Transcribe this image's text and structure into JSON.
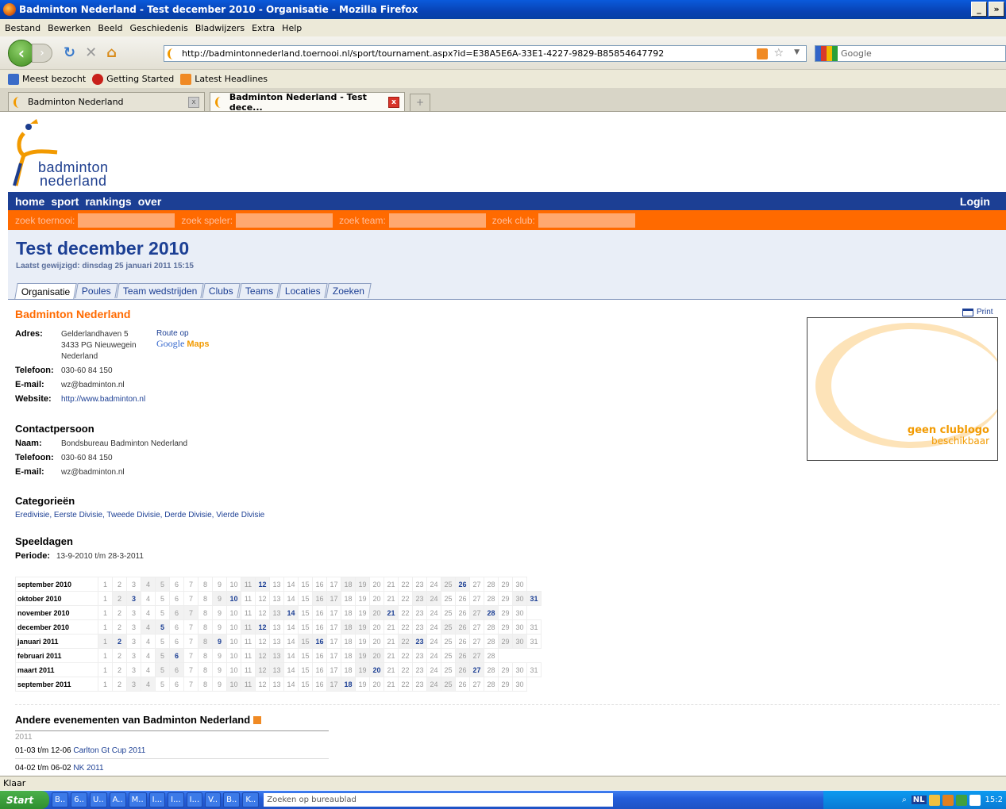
{
  "window": {
    "title": "Badminton Nederland - Test december 2010 - Organisatie - Mozilla Firefox",
    "min": "_",
    "max": "»"
  },
  "menu": [
    "Bestand",
    "Bewerken",
    "Beeld",
    "Geschiedenis",
    "Bladwijzers",
    "Extra",
    "Help"
  ],
  "url": "http://badmintonnederland.toernooi.nl/sport/tournament.aspx?id=E38A5E6A-33E1-4227-9829-B85854647792",
  "search_placeholder": "Google",
  "bookmarks": [
    "Meest bezocht",
    "Getting Started",
    "Latest Headlines"
  ],
  "tabs": [
    {
      "label": "Badminton Nederland"
    },
    {
      "label": "Badminton Nederland - Test dece..."
    }
  ],
  "logo": {
    "line1": "badminton",
    "line2": "nederland"
  },
  "mainnav": {
    "items": [
      "home",
      "sport",
      "rankings",
      "over"
    ],
    "login": "Login"
  },
  "searchstrip": [
    "zoek toernooi:",
    "zoek speler:",
    "zoek team:",
    "zoek club:"
  ],
  "page": {
    "title": "Test december 2010",
    "subtitle": "Laatst gewijzigd: dinsdag 25 januari 2011 15:15",
    "tabs": [
      "Organisatie",
      "Poules",
      "Team wedstrijden",
      "Clubs",
      "Teams",
      "Locaties",
      "Zoeken"
    ]
  },
  "org": {
    "name": "Badminton Nederland",
    "print": "Print",
    "adres_label": "Adres:",
    "adres": [
      "Gelderlandhaven 5",
      "3433 PG Nieuwegein",
      "Nederland"
    ],
    "route": "Route op",
    "maps_google": "Google",
    "maps_maps": "Maps",
    "telefoon_label": "Telefoon:",
    "telefoon": "030-60 84 150",
    "email_label": "E-mail:",
    "email": "wz@badminton.nl",
    "website_label": "Website:",
    "website": "http://www.badminton.nl"
  },
  "logobox": {
    "line1": "geen clublogo",
    "line2": "beschikbaar"
  },
  "contact": {
    "heading": "Contactpersoon",
    "naam_label": "Naam:",
    "naam": "Bondsbureau Badminton Nederland",
    "telefoon_label": "Telefoon:",
    "telefoon": "030-60 84 150",
    "email_label": "E-mail:",
    "email": "wz@badminton.nl"
  },
  "categories": {
    "heading": "Categorieën",
    "list": "Eredivisie, Eerste Divisie, Tweede Divisie, Derde Divisie, Vierde Divisie"
  },
  "speeldagen": {
    "heading": "Speeldagen",
    "periode_label": "Periode:",
    "periode": "13-9-2010 t/m 28-3-2011",
    "months": [
      {
        "name": "september 2010",
        "days": 30,
        "highlight": [
          12,
          26
        ],
        "weekend_start": 4
      },
      {
        "name": "oktober 2010",
        "days": 31,
        "highlight": [
          3,
          10,
          31
        ],
        "weekend_start": 2
      },
      {
        "name": "november 2010",
        "days": 30,
        "highlight": [
          14,
          21,
          28
        ],
        "weekend_start": 6
      },
      {
        "name": "december 2010",
        "days": 31,
        "highlight": [
          5,
          12
        ],
        "weekend_start": 4
      },
      {
        "name": "januari 2011",
        "days": 31,
        "highlight": [
          2,
          9,
          16,
          23
        ],
        "weekend_start": 1
      },
      {
        "name": "februari 2011",
        "days": 28,
        "highlight": [
          6
        ],
        "weekend_start": 5
      },
      {
        "name": "maart 2011",
        "days": 31,
        "highlight": [
          20,
          27
        ],
        "weekend_start": 5
      },
      {
        "name": "september 2011",
        "days": 30,
        "highlight": [
          18
        ],
        "weekend_start": 3
      }
    ]
  },
  "events": {
    "heading": "Andere evenementen van Badminton Nederland",
    "year": "2011",
    "rows": [
      {
        "date": "01-03 t/m 12-06",
        "name": "Carlton Gt Cup 2011"
      },
      {
        "date": "04-02 t/m 06-02",
        "name": "NK 2011"
      }
    ]
  },
  "status": "Klaar",
  "taskbar": {
    "start": "Start",
    "items": [
      "B..",
      "6..",
      "U..",
      "A..",
      "M..",
      "I...",
      "I...",
      "I...",
      "V..",
      "B..",
      "K.."
    ],
    "search": "Zoeken op bureaublad",
    "lang": "NL",
    "clock": "15:2"
  }
}
